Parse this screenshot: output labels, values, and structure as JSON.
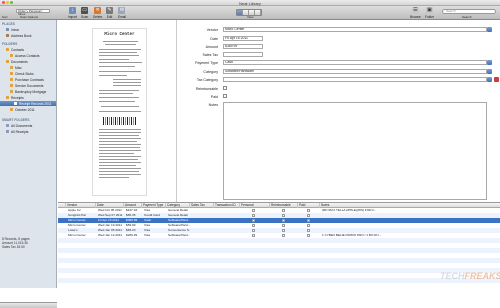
{
  "window": {
    "title": "Neat Library"
  },
  "toolbar": {
    "sort_value": "Order v Personal / Inbox",
    "sort_label": "Sort",
    "scan_options_label": "Scan Options",
    "buttons": [
      {
        "label": "Import",
        "icon": "import-icon"
      },
      {
        "label": "Scan",
        "icon": "scan-icon"
      },
      {
        "label": "Delete",
        "icon": "delete-icon"
      },
      {
        "label": "Edit",
        "icon": "edit-icon"
      },
      {
        "label": "Email",
        "icon": "email-icon"
      }
    ],
    "view_label": "View",
    "browse_label": "Browse",
    "folder_label": "Folder",
    "search_label": "Search",
    "search_placeholder": "Search",
    "accent": "#4472b0"
  },
  "sidebar": {
    "sections": [
      {
        "label": "Places",
        "items": [
          {
            "label": "Inbox"
          },
          {
            "label": "Address Book"
          }
        ]
      },
      {
        "label": "Folders",
        "items": [
          {
            "label": "Contacts"
          },
          {
            "label": "Access Contacts"
          },
          {
            "label": "Documents"
          },
          {
            "label": "Misc"
          },
          {
            "label": "Check Stubs"
          },
          {
            "label": "Purchase Contracts"
          },
          {
            "label": "Service Documents"
          },
          {
            "label": "Bankruptcy Mortgage"
          },
          {
            "label": "Receipts"
          },
          {
            "label": "Receipt Records 2011",
            "selected": true
          },
          {
            "label": "October 2011"
          }
        ]
      },
      {
        "label": "Smart Folders",
        "items": [
          {
            "label": "All Documents"
          },
          {
            "label": "All Receipts"
          }
        ]
      }
    ],
    "stats": [
      "8 Records, 8 pages",
      "Amount 11,016.36",
      "Sales Tax 18.50"
    ]
  },
  "form": {
    "fields": [
      {
        "label": "Vendor",
        "value": "Micro Center"
      },
      {
        "label": "Date",
        "value": "Fri Apr 15 2011"
      },
      {
        "label": "Amount",
        "value": "$389.99"
      },
      {
        "label": "Sales Tax",
        "value": ""
      },
      {
        "label": "Payment Type",
        "value": "Cash"
      },
      {
        "label": "Category",
        "value": "Software/Hardware"
      },
      {
        "label": "Tax Category",
        "value": ""
      },
      {
        "label": "Reimbursable",
        "value": ""
      },
      {
        "label": "Paid",
        "value": ""
      },
      {
        "label": "Notes",
        "value": ""
      }
    ]
  },
  "receipt": {
    "header": "Micro Center"
  },
  "table": {
    "columns": [
      "Vendor",
      "Date",
      "Amount",
      "Payment Type",
      "Category",
      "Sales Tax",
      "Transaction ID",
      "Personal",
      "Reimbursable",
      "Paid",
      "Notes"
    ],
    "rows": [
      {
        "vendor": "Apple Inc",
        "date": "Wed Oct 05 2011",
        "amount": "$167.94",
        "payment": "Visa",
        "category": "General Retail",
        "notes": "(RD 0M 0 TELLA APPLE)(WS) FOR F..."
      },
      {
        "vendor": "Songbird Pal",
        "date": "Wed Sep 07 2011",
        "amount": "$65.35",
        "payment": "Credit Card",
        "category": "General Retail",
        "notes": ""
      },
      {
        "vendor": "Micro Center",
        "date": "Fri Apr 15 2011",
        "amount": "$389.99",
        "payment": "Cash",
        "category": "Software/Hard...",
        "notes": "",
        "selected": true
      },
      {
        "vendor": "Micro Center",
        "date": "Wed Jan 19 2011",
        "amount": "$59.99",
        "payment": "Visa",
        "category": "Software/Hard...",
        "notes": ""
      },
      {
        "vendor": "Lowe's",
        "date": "Wed Jan 05 2011",
        "amount": "$83.23",
        "payment": "Visa",
        "category": "Convenience S...",
        "notes": ""
      },
      {
        "vendor": "Micro Center",
        "date": "Wed Jan 12 2011",
        "amount": "$269.99",
        "payment": "Visa",
        "category": "Software/Hard...",
        "notes": "1 CYBEX BELIE PAPRO PRO / 1 BO RU..."
      }
    ]
  },
  "watermark": {
    "part1": "TECH",
    "part2": "FREAKS"
  }
}
